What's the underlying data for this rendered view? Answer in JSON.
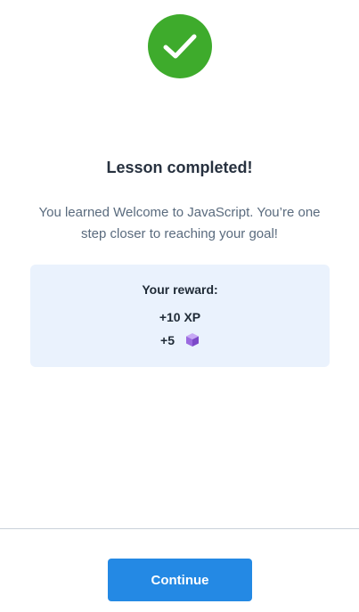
{
  "header": {
    "status_icon": "check-circle-icon",
    "status_color": "#3eab2c"
  },
  "content": {
    "title": "Lesson completed!",
    "message": "You learned Welcome to JavaScript. You’re one step closer to reaching your goal!"
  },
  "reward": {
    "title": "Your reward:",
    "xp": "+10 XP",
    "gems": "+5",
    "gem_icon": "gem-icon",
    "background": "#eaf2fd"
  },
  "footer": {
    "continue_label": "Continue",
    "button_color": "#2489e4"
  }
}
